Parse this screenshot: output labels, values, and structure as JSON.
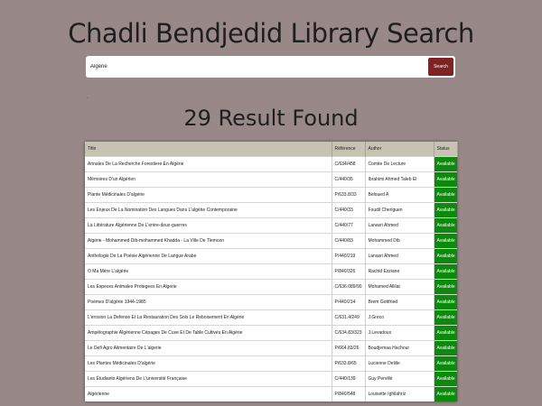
{
  "page": {
    "title": "Chadli Bendjedid Library Search",
    "result_count": "29 Result Found"
  },
  "search": {
    "value": "Algérie",
    "button_label": "Search"
  },
  "marker": ".",
  "colors": {
    "background": "#988888",
    "search_button": "#7d2323",
    "available": "#0c8a0c",
    "table_header": "#c8c2b5"
  },
  "table": {
    "headers": [
      "Title",
      "Référence",
      "Author",
      "Status"
    ],
    "rows": [
      [
        "Annales De La Recherche Forestiere En Algérie",
        "C/634/458",
        "Comite De Lecture",
        "Available"
      ],
      [
        "Mémoires D'un Algérien",
        "C/440/35",
        "Ibrahimi Ahmed Taleb El",
        "Available"
      ],
      [
        "Plante Médicinales D'algérie",
        "P/633.8/33",
        "Beloued A",
        "Available"
      ],
      [
        "Les Enjeux De La Nomination Des Langues Dans L'algérie Contemporaine",
        "C/440/33",
        "Foudil Cheriguen",
        "Available"
      ],
      [
        "La Littérature Algérienne De L'entre-deux-guerres",
        "C/440/77",
        "Lanasri Ahmed",
        "Available"
      ],
      [
        "Algérie - Mohammed Dib-mohammed Khadda - La Ville De Tlemcen",
        "C/440/83",
        "Mohammed Dib",
        "Available"
      ],
      [
        "Anthologie De La Poésie Algérienne De Langue Arabe",
        "P/440/219",
        "Lanasri Ahmed",
        "Available"
      ],
      [
        "O Ma Mère L'algérie",
        "P/840/326",
        "Rachid Ezziane",
        "Available"
      ],
      [
        "Les Especes Animales Protegees En Algerie",
        "C/636.089/90",
        "Mohamed Allilat",
        "Available"
      ],
      [
        "Poèmes D'algérie 1944-1985",
        "P/440/214",
        "Brem Gottfried",
        "Available"
      ],
      [
        "L'erosion La Defense Et La Restauration Des Sols Le Reboisement En Algérie",
        "C/631.4/249",
        "J.Greco",
        "Available"
      ],
      [
        "Ampélographie Algérienne Cépages De Cuve Et De Table Cultivés En Algérie",
        "C/634.83/323",
        "J.Levadoux",
        "Available"
      ],
      [
        "Le Defi Agro Alimentaire De L'algerie",
        "P/664.83/26",
        "Boudjemaa Hachour",
        "Available"
      ],
      [
        "Les Plantes Médicinales D'algérie",
        "P/633.8/65",
        "Lucienne Deliile",
        "Available"
      ],
      [
        "Les Étudiants Algériens De L'université Française",
        "C/440/139",
        "Guy Pervillé",
        "Available"
      ],
      [
        "Algérienne",
        "P/840/548",
        "Louisette Ighilahriz",
        "Available"
      ]
    ]
  }
}
